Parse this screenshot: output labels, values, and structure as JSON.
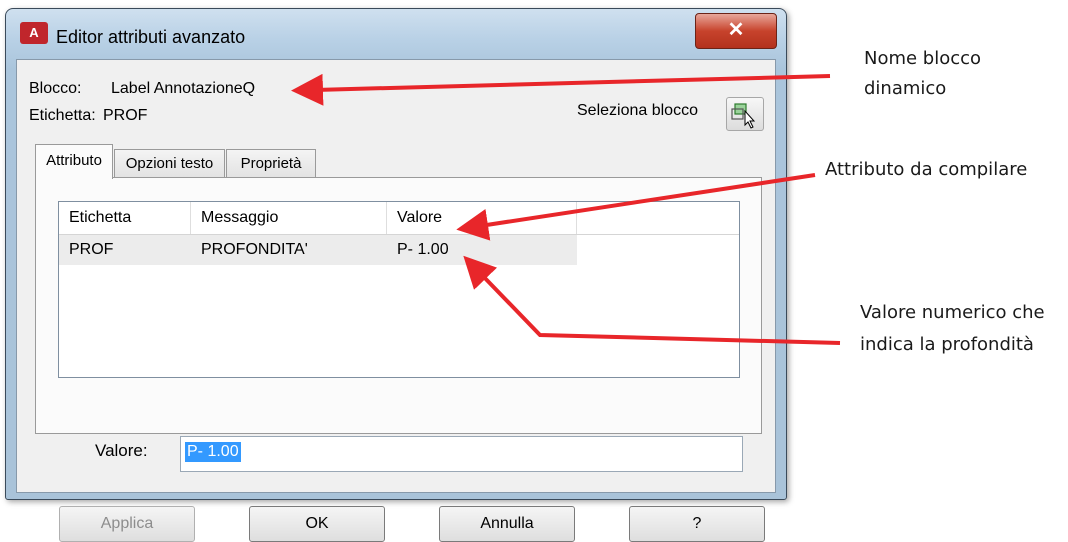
{
  "window": {
    "title": "Editor attributi avanzato",
    "app_icon_text": "A",
    "close_glyph": "✕"
  },
  "info": {
    "block_label": "Blocco:",
    "block_value": "Label AnnotazioneQ",
    "tag_label": "Etichetta:",
    "tag_value": "PROF",
    "select_block": "Seleziona blocco"
  },
  "tabs": [
    {
      "label": "Attributo"
    },
    {
      "label": "Opzioni testo"
    },
    {
      "label": "Proprietà"
    }
  ],
  "table": {
    "headers": [
      "Etichetta",
      "Messaggio",
      "Valore"
    ],
    "rows": [
      [
        "PROF",
        "PROFONDITA'",
        "P- 1.00"
      ]
    ]
  },
  "value_field": {
    "label": "Valore:",
    "value": "P- 1.00"
  },
  "buttons": {
    "apply": "Applica",
    "ok": "OK",
    "cancel": "Annulla",
    "help": "?"
  },
  "annotations": {
    "block_name_line1": "Nome blocco",
    "block_name_line2": "dinamico",
    "attribute": "Attributo da compilare",
    "value_line1": "Valore numerico che",
    "value_line2": "indica la profondità"
  },
  "colors": {
    "arrow": "#e8262a",
    "selection": "#3399ff"
  },
  "icons": {
    "app": "autocad-icon",
    "close": "close-icon",
    "select_block": "select-block-cursor-icon"
  }
}
